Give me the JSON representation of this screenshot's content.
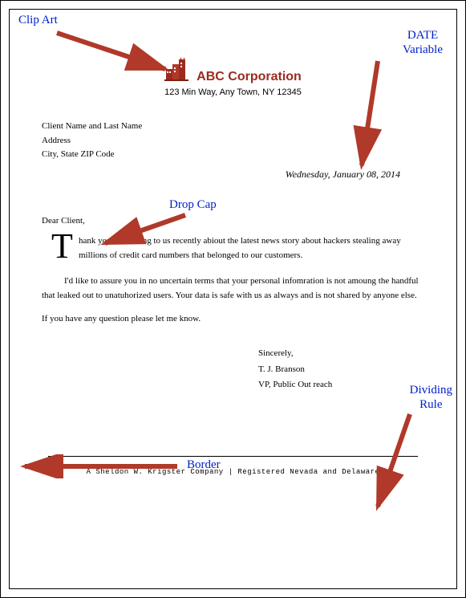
{
  "annotations": {
    "clip_art": "Clip Art",
    "date_variable_l1": "DATE",
    "date_variable_l2": "Variable",
    "drop_cap": "Drop Cap",
    "dividing_rule_l1": "Dividing",
    "dividing_rule_l2": "Rule",
    "border": "Border"
  },
  "letterhead": {
    "company": "ABC Corporation",
    "address": "123 Min Way, Any Town, NY 12345"
  },
  "recipient": {
    "name": "Client Name and Last Name",
    "address": "Address",
    "csz": "City, State ZIP Code"
  },
  "date": "Wednesday, January 08, 2014",
  "salutation": "Dear Client,",
  "body": {
    "drop_letter": "T",
    "p1": "hank you for writing to us recently abiout the latest news story about hackers stealing away millions of credit card numbers that belonged to our customers.",
    "p2": "I'd like to assure you in no uncertain terms that your personal infomration is not amoung the handful that leaked out to unatuhorized users. Your data is safe with us as always and is not shared by anyone else.",
    "p3": "If you have any question please let me know."
  },
  "signature": {
    "closing": "Sincerely,",
    "name": "T. J. Branson",
    "title": "VP, Public Out reach"
  },
  "footer": "A Sheldon W. Krigster Company | Registered Nevada and Delaware"
}
